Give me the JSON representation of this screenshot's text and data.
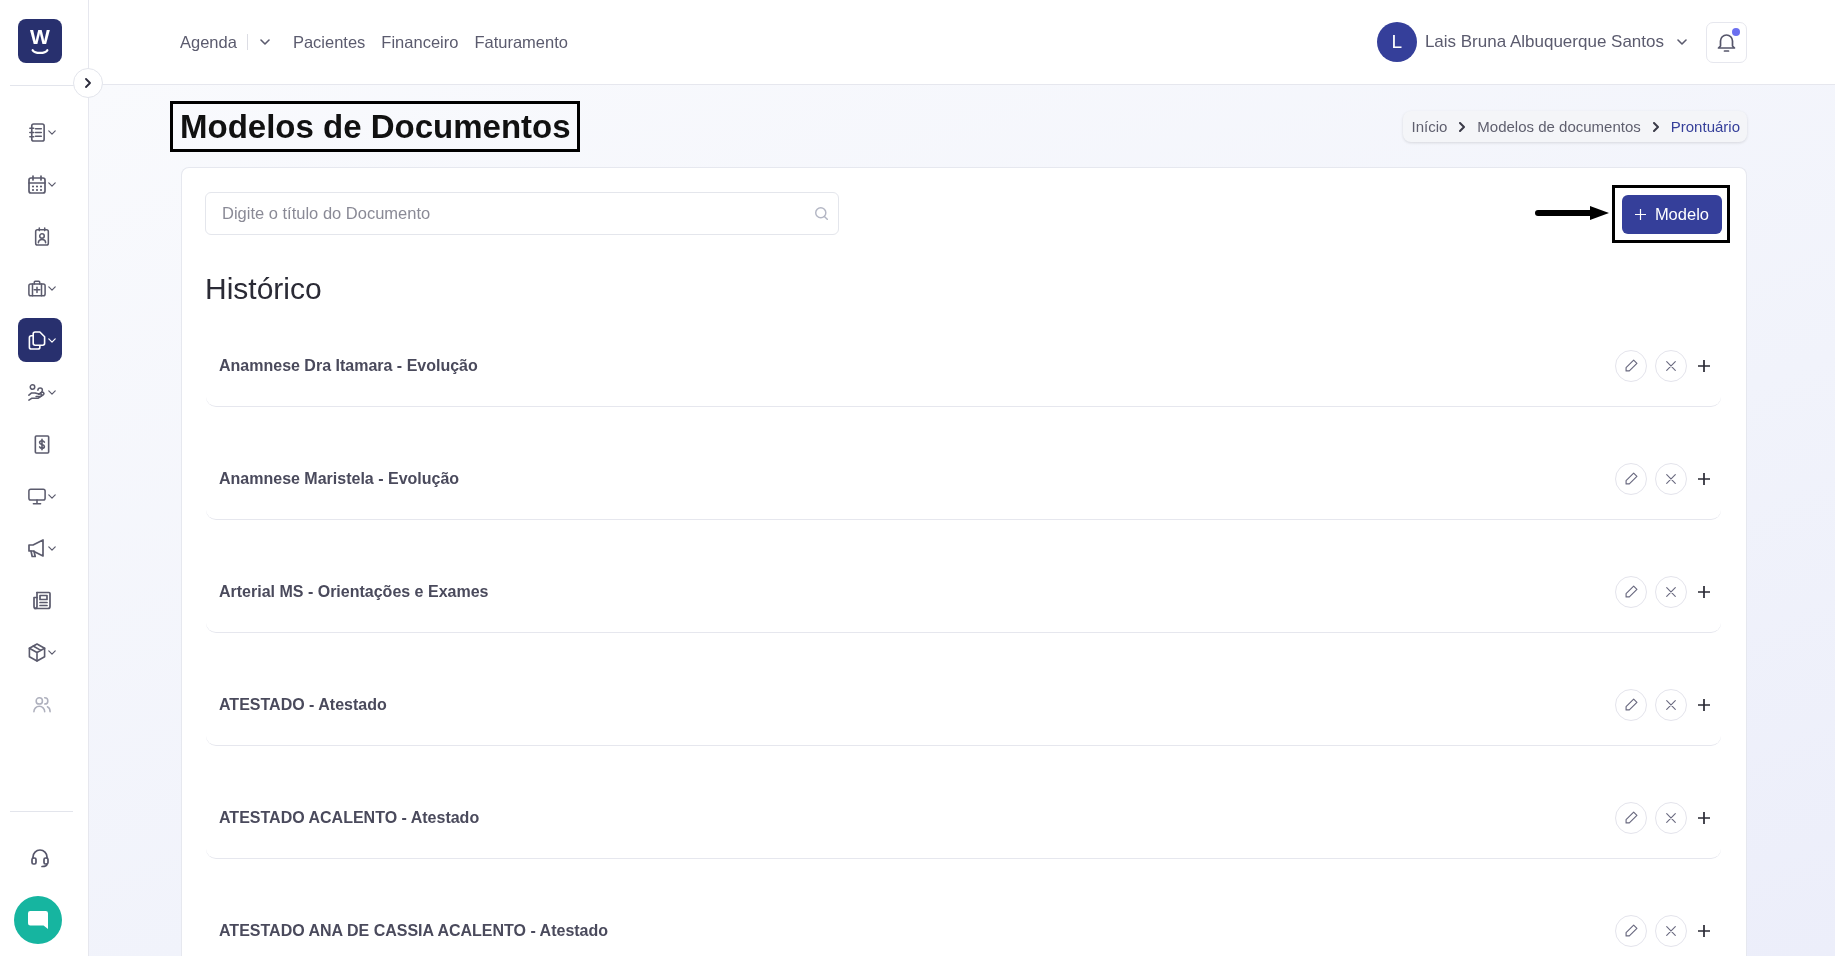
{
  "sidebar": {
    "logo": {
      "mark": "W"
    },
    "items": [
      {
        "has_submenu": true,
        "selected": false,
        "disabled": false
      },
      {
        "has_submenu": true,
        "selected": false,
        "disabled": false
      },
      {
        "has_submenu": false,
        "selected": false,
        "disabled": false
      },
      {
        "has_submenu": true,
        "selected": false,
        "disabled": false
      },
      {
        "has_submenu": true,
        "selected": true,
        "disabled": false
      },
      {
        "has_submenu": true,
        "selected": false,
        "disabled": false
      },
      {
        "has_submenu": false,
        "selected": false,
        "disabled": false
      },
      {
        "has_submenu": true,
        "selected": false,
        "disabled": false
      },
      {
        "has_submenu": true,
        "selected": false,
        "disabled": false
      },
      {
        "has_submenu": false,
        "selected": false,
        "disabled": false
      },
      {
        "has_submenu": true,
        "selected": false,
        "disabled": false
      },
      {
        "has_submenu": false,
        "selected": false,
        "disabled": true
      }
    ]
  },
  "topbar": {
    "nav": [
      {
        "label": "Agenda",
        "dropdown": true
      },
      {
        "label": "Pacientes",
        "dropdown": false
      },
      {
        "label": "Financeiro",
        "dropdown": false
      },
      {
        "label": "Faturamento",
        "dropdown": false
      }
    ],
    "user": {
      "initial": "L",
      "name": "Lais Bruna Albuquerque Santos"
    },
    "notifications": {
      "unread": true
    }
  },
  "page": {
    "title": "Modelos de Documentos",
    "breadcrumb": [
      {
        "label": "Início",
        "selected": false
      },
      {
        "label": "Modelos de documentos",
        "selected": false
      },
      {
        "label": "Prontuário",
        "selected": true
      }
    ]
  },
  "annotations": {
    "title_box": true,
    "button_box": true,
    "arrow": true
  },
  "toolbar": {
    "search": {
      "placeholder": "Digite o título do Documento"
    },
    "add_button": {
      "label": "Modelo"
    }
  },
  "history": {
    "title": "Histórico",
    "documents": [
      {
        "title": "Anamnese Dra Itamara - Evolução"
      },
      {
        "title": "Anamnese Maristela - Evolução"
      },
      {
        "title": "Arterial MS - Orientações e Exames"
      },
      {
        "title": "ATESTADO - Atestado"
      },
      {
        "title": "ATESTADO ACALENTO - Atestado"
      },
      {
        "title": "ATESTADO ANA DE CASSIA ACALENTO - Atestado"
      }
    ]
  }
}
